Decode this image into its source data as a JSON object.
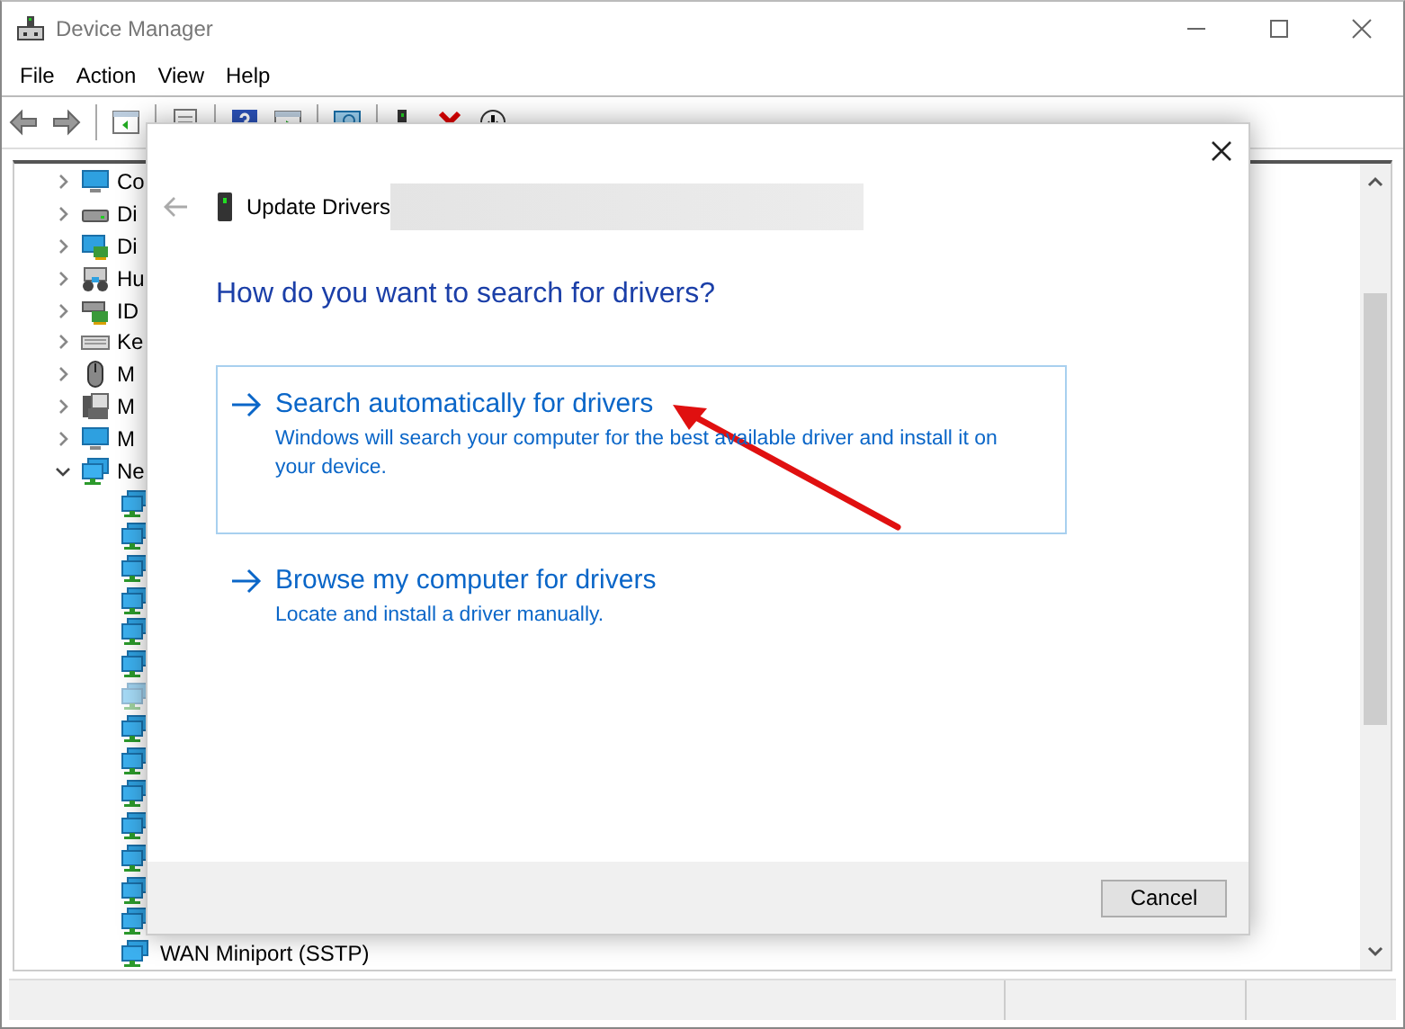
{
  "window": {
    "title": "Device Manager"
  },
  "menu": [
    "File",
    "Action",
    "View",
    "Help"
  ],
  "tree": {
    "items": [
      {
        "label": "Co",
        "kind": "computer",
        "expanded": false
      },
      {
        "label": "Di",
        "kind": "disk",
        "expanded": false
      },
      {
        "label": "Di",
        "kind": "display",
        "expanded": false
      },
      {
        "label": "Hu",
        "kind": "hid",
        "expanded": false
      },
      {
        "label": "ID",
        "kind": "ide",
        "expanded": false
      },
      {
        "label": "Ke",
        "kind": "keyboard",
        "expanded": false
      },
      {
        "label": "M",
        "kind": "mouse",
        "expanded": false
      },
      {
        "label": "M",
        "kind": "modem",
        "expanded": false
      },
      {
        "label": "M",
        "kind": "monitor",
        "expanded": false
      },
      {
        "label": "Ne",
        "kind": "network",
        "expanded": true,
        "children": [
          {
            "disabled": false
          },
          {
            "disabled": false
          },
          {
            "disabled": false
          },
          {
            "disabled": false
          },
          {
            "disabled": false
          },
          {
            "disabled": false
          },
          {
            "disabled": true
          },
          {
            "disabled": false
          },
          {
            "disabled": false
          },
          {
            "disabled": false
          },
          {
            "disabled": false
          },
          {
            "disabled": false
          },
          {
            "disabled": false
          },
          {
            "disabled": false
          },
          {
            "label": "WAN Miniport (SSTP)",
            "disabled": false
          }
        ]
      }
    ]
  },
  "dialog": {
    "title": "Update Drivers",
    "heading": "How do you want to search for drivers?",
    "options": [
      {
        "title": "Search automatically for drivers",
        "description": "Windows will search your computer for the best available driver and install it on your device.",
        "selected": true
      },
      {
        "title": "Browse my computer for drivers",
        "description": "Locate and install a driver manually.",
        "selected": false
      }
    ],
    "buttons": [
      "Cancel"
    ]
  }
}
